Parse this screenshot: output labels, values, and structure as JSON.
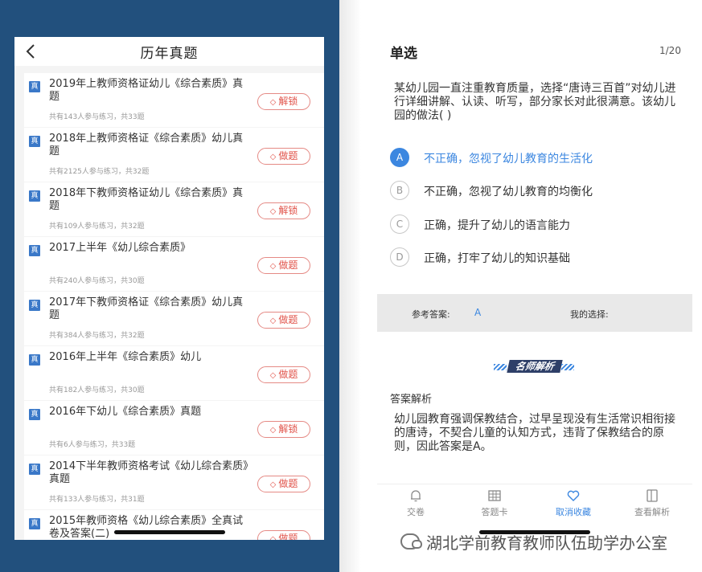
{
  "left": {
    "title": "历年真题",
    "badge": "真",
    "items": [
      {
        "title": "2019年上教师资格证幼儿《综合素质》真题",
        "meta": "共有143人参与练习，共33题",
        "action": "解锁"
      },
      {
        "title": "2018年上教师资格证《综合素质》幼儿真题",
        "meta": "共有2125人参与练习，共32题",
        "action": "做题"
      },
      {
        "title": "2018年下教师资格证幼儿《综合素质》真题",
        "meta": "共有109人参与练习，共32题",
        "action": "解锁"
      },
      {
        "title": "2017上半年《幼儿综合素质》",
        "meta": "共有240人参与练习，共30题",
        "action": "做题"
      },
      {
        "title": "2017年下教师资格证《综合素质》幼儿真题",
        "meta": "共有384人参与练习，共32题",
        "action": "做题"
      },
      {
        "title": "2016年上半年《综合素质》幼儿",
        "meta": "共有182人参与练习，共30题",
        "action": "做题"
      },
      {
        "title": "2016年下幼儿《综合素质》真题",
        "meta": "共有6人参与练习，共33题",
        "action": "解锁"
      },
      {
        "title": "2014下半年教师资格考试《幼儿综合素质》真题",
        "meta": "共有133人参与练习，共31题",
        "action": "做题"
      },
      {
        "title": "2015年教师资格《幼儿综合素质》全真试卷及答案(二)",
        "meta": "",
        "action": "做题"
      }
    ]
  },
  "right": {
    "question_type": "单选",
    "progress": "1/20",
    "question": "某幼儿园一直注重教育质量，选择“唐诗三百首”对幼儿进行详细讲解、认读、听写，部分家长对此很满意。该幼儿园的做法(    )",
    "options": [
      {
        "letter": "A",
        "text": "不正确，忽视了幼儿教育的生活化"
      },
      {
        "letter": "B",
        "text": "不正确，忽视了幼儿教育的均衡化"
      },
      {
        "letter": "C",
        "text": "正确，提升了幼儿的语言能力"
      },
      {
        "letter": "D",
        "text": "正确，打牢了幼儿的知识基础"
      }
    ],
    "selected_option": "A",
    "answer_bar": {
      "ref_label": "参考答案:",
      "ref_value": "A",
      "my_label": "我的选择:"
    },
    "teacher_label": "名师解析",
    "analysis_heading": "答案解析",
    "analysis_text": "幼儿园教育强调保教结合，过早呈现没有生活常识相衔接的唐诗，不契合儿童的认知方式，违背了保教结合的原则，因此答案是A。",
    "toolbar": [
      {
        "label": "交卷",
        "icon": "bell-icon"
      },
      {
        "label": "答题卡",
        "icon": "grid-card-icon"
      },
      {
        "label": "取消收藏",
        "icon": "heart-icon"
      },
      {
        "label": "查看解析",
        "icon": "book-icon"
      }
    ],
    "watermark": "湖北学前教育教师队伍助学办公室",
    "accent_color": "#3c87e0"
  }
}
